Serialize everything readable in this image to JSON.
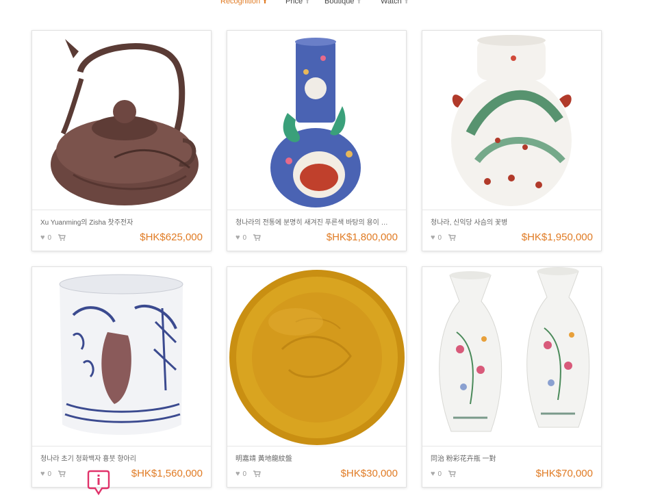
{
  "sort_bar": [
    {
      "label": "Recognition",
      "arrow": "⬆",
      "active": true
    },
    {
      "label": "Price",
      "arrow": "⬆",
      "active": false
    },
    {
      "label": "Boutique",
      "arrow": "⬆",
      "active": false
    },
    {
      "label": "Watch",
      "arrow": "⬆",
      "active": false
    }
  ],
  "products": [
    {
      "title": "Xu Yuanming의 Zisha 찻주전자",
      "likes": "0",
      "price": "$HK$625,000",
      "image": "teapot"
    },
    {
      "title": "청나라의 전통에 분명히 새겨진 푸른색 바탕의 용이 …",
      "likes": "0",
      "price": "$HK$1,800,000",
      "image": "dragon-vase"
    },
    {
      "title": "청나라, 신익당 사슴의 꽃병",
      "likes": "0",
      "price": "$HK$1,950,000",
      "image": "deer-vase"
    },
    {
      "title": "청나라 초기 청화백자 흉붓 항아리",
      "likes": "0",
      "price": "$HK$1,560,000",
      "image": "brush-pot"
    },
    {
      "title": "明嘉靖 黃地龍紋盤",
      "likes": "0",
      "price": "$HK$30,000",
      "image": "yellow-plate"
    },
    {
      "title": "同治 粉彩花卉瓶 一對",
      "likes": "0",
      "price": "$HK$70,000",
      "image": "vase-pair"
    }
  ],
  "colors": {
    "accent": "#e07b24",
    "float_button": "#e0326a"
  },
  "icons": {
    "heart": "heart-icon",
    "cart": "cart-icon",
    "float": "chat-info-icon"
  }
}
